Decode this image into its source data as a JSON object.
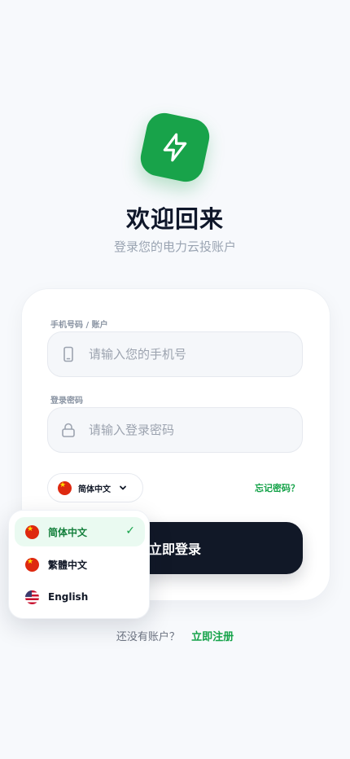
{
  "header": {
    "title": "欢迎回来",
    "subtitle": "登录您的电力云投账户"
  },
  "form": {
    "phone_label": "手机号码 / 账户",
    "phone_placeholder": "请输入您的手机号",
    "password_label": "登录密码",
    "password_placeholder": "请输入登录密码",
    "forgot_label": "忘记密码？",
    "login_label": "立即登录"
  },
  "language": {
    "selected": "简体中文",
    "options": [
      {
        "label": "简体中文",
        "flag": "cn-flag-icon",
        "selected": true
      },
      {
        "label": "繁體中文",
        "flag": "cn-flag-icon",
        "selected": false
      },
      {
        "label": "English",
        "flag": "us-flag-icon",
        "selected": false
      }
    ],
    "check_mark": "✓"
  },
  "footer": {
    "prompt": "还没有账户？",
    "register_label": "立即注册"
  },
  "colors": {
    "accent": "#16a34a",
    "logo_bg": "#18a34a",
    "button_bg": "#111827",
    "page_bg": "#f7f9fc"
  },
  "icons": {
    "logo": "lightning-bolt-icon",
    "phone": "smartphone-icon",
    "password": "lock-icon",
    "dropdown": "chevron-down-icon"
  }
}
